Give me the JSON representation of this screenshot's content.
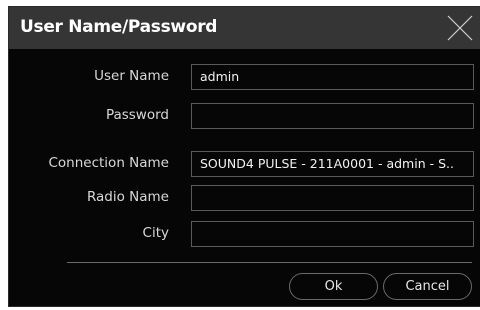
{
  "dialog": {
    "title": "User Name/Password",
    "close_icon": "close-x-icon"
  },
  "fields": [
    {
      "label": "User Name",
      "value": "admin"
    },
    {
      "label": "Password",
      "value": ""
    },
    {
      "label": "Connection Name",
      "value": "SOUND4 PULSE - 211A0001 - admin - S.."
    },
    {
      "label": "Radio Name",
      "value": ""
    },
    {
      "label": "City",
      "value": ""
    }
  ],
  "buttons": {
    "ok_label": "Ok",
    "cancel_label": "Cancel"
  },
  "colors": {
    "titlebar": "#353535",
    "background": "#060606",
    "field_border": "#5a5a5a",
    "text": "#ffffff"
  }
}
